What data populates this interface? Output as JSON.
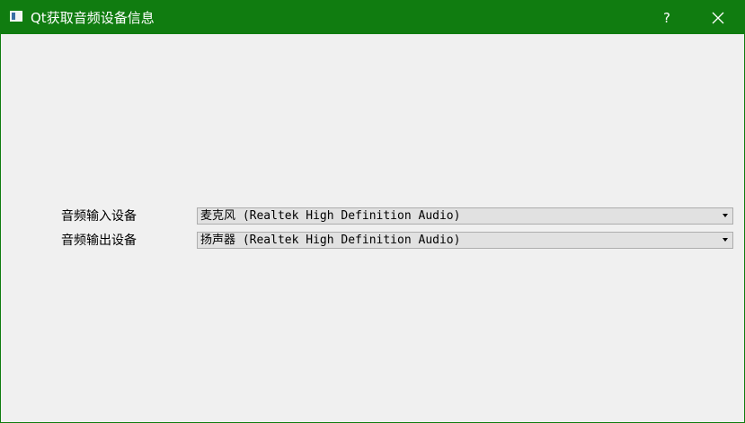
{
  "window": {
    "title": "Qt获取音频设备信息",
    "help_label": "?",
    "accent_color": "#107c10"
  },
  "icons": {
    "app": "app-window-icon",
    "close": "close-icon",
    "dropdown": "chevron-down-icon"
  },
  "form": {
    "input_device": {
      "label": "音频输入设备",
      "selected": "麦克风 (Realtek High Definition Audio)"
    },
    "output_device": {
      "label": "音频输出设备",
      "selected": "扬声器 (Realtek High Definition Audio)"
    }
  }
}
